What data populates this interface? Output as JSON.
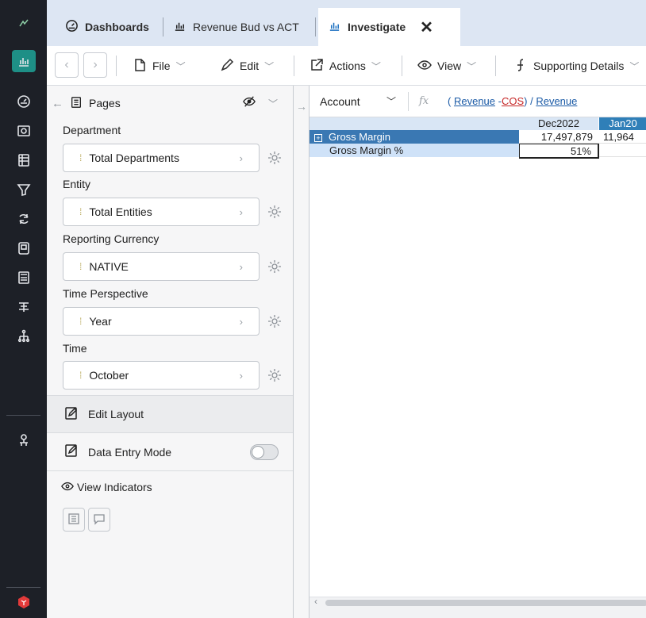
{
  "tabs": [
    {
      "label": "Dashboards",
      "icon": "dashboard-icon",
      "bold": true
    },
    {
      "label": "Revenue Bud vs ACT",
      "icon": "chart-icon",
      "bold": false
    },
    {
      "label": "Investigate",
      "icon": "chart-icon",
      "bold": true,
      "active": true
    }
  ],
  "toolbar": {
    "file": "File",
    "edit": "Edit",
    "actions": "Actions",
    "view": "View",
    "supporting": "Supporting Details"
  },
  "panel": {
    "title": "Pages",
    "dimensions": [
      {
        "label": "Department",
        "value": "Total Departments"
      },
      {
        "label": "Entity",
        "value": "Total Entities"
      },
      {
        "label": "Reporting Currency",
        "value": "NATIVE"
      },
      {
        "label": "Time Perspective",
        "value": "Year"
      },
      {
        "label": "Time",
        "value": "October"
      }
    ],
    "edit_layout": "Edit Layout",
    "data_entry_mode": "Data Entry Mode",
    "view_indicators": "View Indicators"
  },
  "formula_bar": {
    "account": "Account",
    "fx": "fx",
    "formula_open": "(",
    "formula_revenue1": "Revenue",
    "formula_minus": " -",
    "formula_cos": "COS",
    "formula_close": ")",
    "formula_slash": " / ",
    "formula_revenue2": "Revenue"
  },
  "grid": {
    "columns": [
      "Dec2022",
      "Jan20"
    ],
    "rows": [
      {
        "label": "Gross Margin",
        "values": [
          "17,497,879",
          "11,964"
        ]
      },
      {
        "label": "Gross Margin %",
        "values": [
          "51%",
          ""
        ]
      }
    ]
  },
  "colors": {
    "accent": "#1e8f86",
    "selected_row": "#3a78b3",
    "header_alt": "#2f7fb8"
  }
}
